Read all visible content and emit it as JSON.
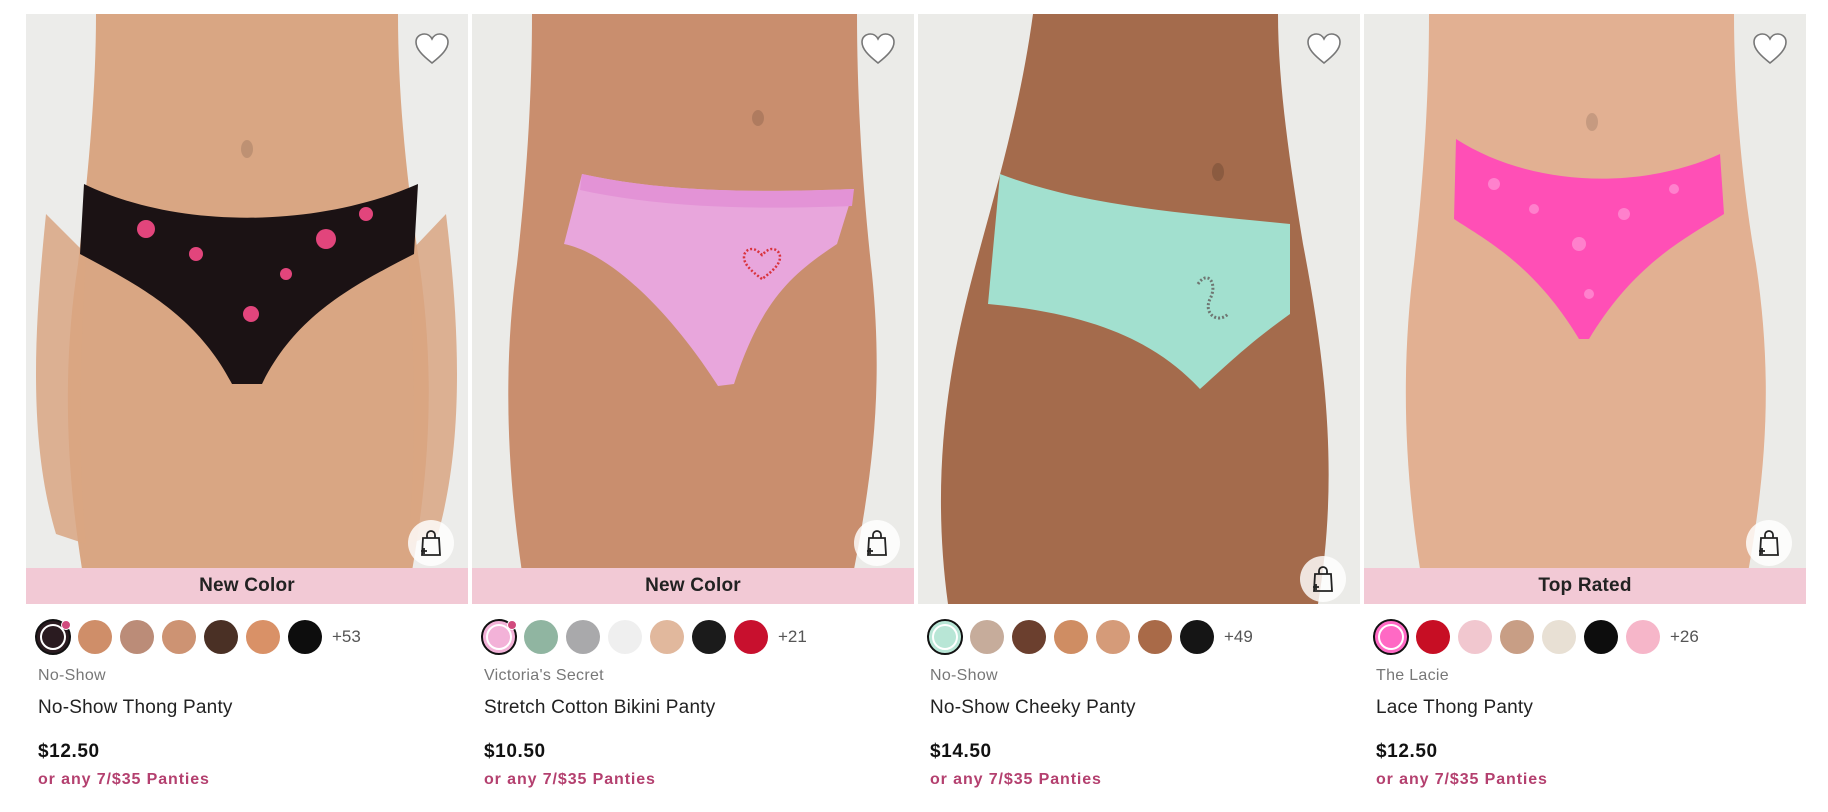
{
  "products": [
    {
      "badge": "New Color",
      "collection": "No-Show",
      "name": "No-Show Thong Panty",
      "price": "$12.50",
      "promo": "or any 7/$35 Panties",
      "more_colors": "+53",
      "panty_color": "#1b1214",
      "panty_accent": "#e2457c",
      "skin": "#d9a683",
      "swatches": [
        "#2a1b20",
        "#cf8e69",
        "#bb8c78",
        "#cd9373",
        "#4a3025",
        "#d99167",
        "#0d0d0d"
      ]
    },
    {
      "badge": "New Color",
      "collection": "Victoria's Secret",
      "name": "Stretch Cotton Bikini Panty",
      "price": "$10.50",
      "promo": "or any 7/$35 Panties",
      "more_colors": "+21",
      "panty_color": "#e8a6dc",
      "panty_accent": "#d9333d",
      "skin": "#c98e6e",
      "swatches": [
        "#f3b2d8",
        "#90b5a1",
        "#a9a9ab",
        "#efefef",
        "#e1b89d",
        "#1b1b1b",
        "#c8102e"
      ]
    },
    {
      "badge": "",
      "collection": "No-Show",
      "name": "No-Show Cheeky Panty",
      "price": "$14.50",
      "promo": "or any 7/$35 Panties",
      "more_colors": "+49",
      "panty_color": "#a2e0cf",
      "panty_accent": "#6f7672",
      "skin": "#a46b4c",
      "swatches": [
        "#b8e6d6",
        "#c6ac9b",
        "#6b3f2e",
        "#cf8d63",
        "#d59b79",
        "#a96a48",
        "#151515"
      ]
    },
    {
      "badge": "Top Rated",
      "collection": "The Lacie",
      "name": "Lace Thong Panty",
      "price": "$12.50",
      "promo": "or any 7/$35 Panties",
      "more_colors": "+26",
      "panty_color": "#ff4fb6",
      "panty_accent": "#ff86cf",
      "skin": "#e2b092",
      "swatches": [
        "#ff69c4",
        "#c70e24",
        "#f1c7cf",
        "#c89e85",
        "#e8e0d4",
        "#0d0d0d",
        "#f6b6c9"
      ]
    }
  ]
}
